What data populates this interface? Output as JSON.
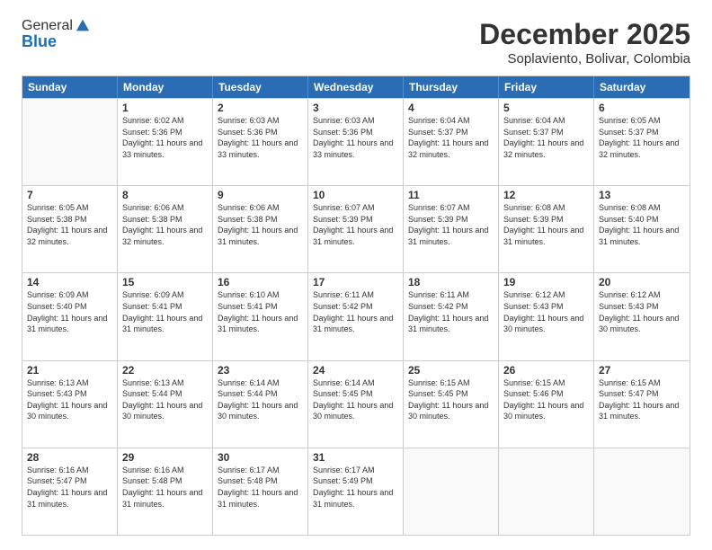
{
  "header": {
    "logo_general": "General",
    "logo_blue": "Blue",
    "month": "December 2025",
    "location": "Soplaviento, Bolivar, Colombia"
  },
  "days_of_week": [
    "Sunday",
    "Monday",
    "Tuesday",
    "Wednesday",
    "Thursday",
    "Friday",
    "Saturday"
  ],
  "weeks": [
    [
      {
        "day": "",
        "empty": true
      },
      {
        "day": "1",
        "sunrise": "Sunrise: 6:02 AM",
        "sunset": "Sunset: 5:36 PM",
        "daylight": "Daylight: 11 hours and 33 minutes."
      },
      {
        "day": "2",
        "sunrise": "Sunrise: 6:03 AM",
        "sunset": "Sunset: 5:36 PM",
        "daylight": "Daylight: 11 hours and 33 minutes."
      },
      {
        "day": "3",
        "sunrise": "Sunrise: 6:03 AM",
        "sunset": "Sunset: 5:36 PM",
        "daylight": "Daylight: 11 hours and 33 minutes."
      },
      {
        "day": "4",
        "sunrise": "Sunrise: 6:04 AM",
        "sunset": "Sunset: 5:37 PM",
        "daylight": "Daylight: 11 hours and 32 minutes."
      },
      {
        "day": "5",
        "sunrise": "Sunrise: 6:04 AM",
        "sunset": "Sunset: 5:37 PM",
        "daylight": "Daylight: 11 hours and 32 minutes."
      },
      {
        "day": "6",
        "sunrise": "Sunrise: 6:05 AM",
        "sunset": "Sunset: 5:37 PM",
        "daylight": "Daylight: 11 hours and 32 minutes."
      }
    ],
    [
      {
        "day": "7",
        "sunrise": "Sunrise: 6:05 AM",
        "sunset": "Sunset: 5:38 PM",
        "daylight": "Daylight: 11 hours and 32 minutes."
      },
      {
        "day": "8",
        "sunrise": "Sunrise: 6:06 AM",
        "sunset": "Sunset: 5:38 PM",
        "daylight": "Daylight: 11 hours and 32 minutes."
      },
      {
        "day": "9",
        "sunrise": "Sunrise: 6:06 AM",
        "sunset": "Sunset: 5:38 PM",
        "daylight": "Daylight: 11 hours and 31 minutes."
      },
      {
        "day": "10",
        "sunrise": "Sunrise: 6:07 AM",
        "sunset": "Sunset: 5:39 PM",
        "daylight": "Daylight: 11 hours and 31 minutes."
      },
      {
        "day": "11",
        "sunrise": "Sunrise: 6:07 AM",
        "sunset": "Sunset: 5:39 PM",
        "daylight": "Daylight: 11 hours and 31 minutes."
      },
      {
        "day": "12",
        "sunrise": "Sunrise: 6:08 AM",
        "sunset": "Sunset: 5:39 PM",
        "daylight": "Daylight: 11 hours and 31 minutes."
      },
      {
        "day": "13",
        "sunrise": "Sunrise: 6:08 AM",
        "sunset": "Sunset: 5:40 PM",
        "daylight": "Daylight: 11 hours and 31 minutes."
      }
    ],
    [
      {
        "day": "14",
        "sunrise": "Sunrise: 6:09 AM",
        "sunset": "Sunset: 5:40 PM",
        "daylight": "Daylight: 11 hours and 31 minutes."
      },
      {
        "day": "15",
        "sunrise": "Sunrise: 6:09 AM",
        "sunset": "Sunset: 5:41 PM",
        "daylight": "Daylight: 11 hours and 31 minutes."
      },
      {
        "day": "16",
        "sunrise": "Sunrise: 6:10 AM",
        "sunset": "Sunset: 5:41 PM",
        "daylight": "Daylight: 11 hours and 31 minutes."
      },
      {
        "day": "17",
        "sunrise": "Sunrise: 6:11 AM",
        "sunset": "Sunset: 5:42 PM",
        "daylight": "Daylight: 11 hours and 31 minutes."
      },
      {
        "day": "18",
        "sunrise": "Sunrise: 6:11 AM",
        "sunset": "Sunset: 5:42 PM",
        "daylight": "Daylight: 11 hours and 31 minutes."
      },
      {
        "day": "19",
        "sunrise": "Sunrise: 6:12 AM",
        "sunset": "Sunset: 5:43 PM",
        "daylight": "Daylight: 11 hours and 30 minutes."
      },
      {
        "day": "20",
        "sunrise": "Sunrise: 6:12 AM",
        "sunset": "Sunset: 5:43 PM",
        "daylight": "Daylight: 11 hours and 30 minutes."
      }
    ],
    [
      {
        "day": "21",
        "sunrise": "Sunrise: 6:13 AM",
        "sunset": "Sunset: 5:43 PM",
        "daylight": "Daylight: 11 hours and 30 minutes."
      },
      {
        "day": "22",
        "sunrise": "Sunrise: 6:13 AM",
        "sunset": "Sunset: 5:44 PM",
        "daylight": "Daylight: 11 hours and 30 minutes."
      },
      {
        "day": "23",
        "sunrise": "Sunrise: 6:14 AM",
        "sunset": "Sunset: 5:44 PM",
        "daylight": "Daylight: 11 hours and 30 minutes."
      },
      {
        "day": "24",
        "sunrise": "Sunrise: 6:14 AM",
        "sunset": "Sunset: 5:45 PM",
        "daylight": "Daylight: 11 hours and 30 minutes."
      },
      {
        "day": "25",
        "sunrise": "Sunrise: 6:15 AM",
        "sunset": "Sunset: 5:45 PM",
        "daylight": "Daylight: 11 hours and 30 minutes."
      },
      {
        "day": "26",
        "sunrise": "Sunrise: 6:15 AM",
        "sunset": "Sunset: 5:46 PM",
        "daylight": "Daylight: 11 hours and 30 minutes."
      },
      {
        "day": "27",
        "sunrise": "Sunrise: 6:15 AM",
        "sunset": "Sunset: 5:47 PM",
        "daylight": "Daylight: 11 hours and 31 minutes."
      }
    ],
    [
      {
        "day": "28",
        "sunrise": "Sunrise: 6:16 AM",
        "sunset": "Sunset: 5:47 PM",
        "daylight": "Daylight: 11 hours and 31 minutes."
      },
      {
        "day": "29",
        "sunrise": "Sunrise: 6:16 AM",
        "sunset": "Sunset: 5:48 PM",
        "daylight": "Daylight: 11 hours and 31 minutes."
      },
      {
        "day": "30",
        "sunrise": "Sunrise: 6:17 AM",
        "sunset": "Sunset: 5:48 PM",
        "daylight": "Daylight: 11 hours and 31 minutes."
      },
      {
        "day": "31",
        "sunrise": "Sunrise: 6:17 AM",
        "sunset": "Sunset: 5:49 PM",
        "daylight": "Daylight: 11 hours and 31 minutes."
      },
      {
        "day": "",
        "empty": true
      },
      {
        "day": "",
        "empty": true
      },
      {
        "day": "",
        "empty": true
      }
    ]
  ]
}
